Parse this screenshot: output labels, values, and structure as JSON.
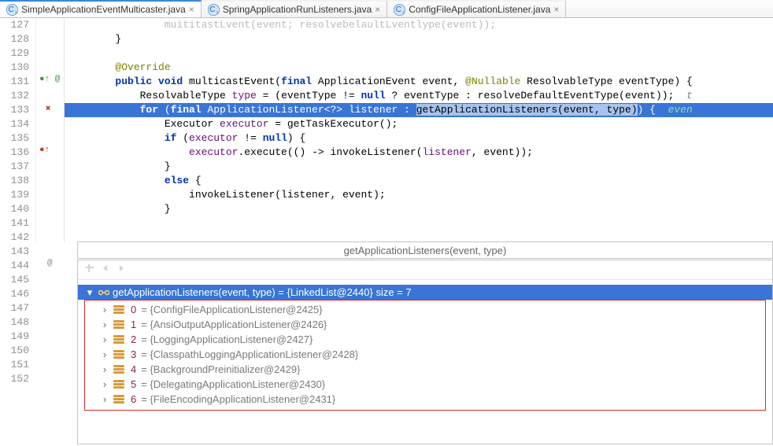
{
  "tabs": [
    {
      "label": "SimpleApplicationEventMulticaster.java",
      "active": true
    },
    {
      "label": "SpringApplicationRunListeners.java",
      "active": false
    },
    {
      "label": "ConfigFileApplicationListener.java",
      "active": false
    }
  ],
  "line_numbers": [
    "127",
    "128",
    "129",
    "130",
    "131",
    "132",
    "133",
    "134",
    "135",
    "136",
    "137",
    "138",
    "139",
    "140",
    "141",
    "142",
    "143",
    "144",
    "145",
    "146",
    "147",
    "148",
    "149",
    "150",
    "151",
    "152"
  ],
  "code": {
    "l0": "muititastLvent(event; resolvebelaultLventlype(event));",
    "l1": "}",
    "l3": "@Override",
    "l4_pre": "public void",
    "l4_name": " multicastEvent(",
    "l4_kw2": "final",
    "l4_mid": " ApplicationEvent event, ",
    "l4_ann": "@Nullable",
    "l4_rest": " ResolvableType eventType) {",
    "l5_pre": "ResolvableType ",
    "l5_var": "type",
    "l5_rest": " = (eventType != ",
    "l5_null": "null",
    "l5_rest2": " ? eventType : resolveDefaultEventType(event));  ",
    "l5_cmt": "t",
    "l6_pre": "for",
    "l6_mid": " (",
    "l6_fin": "final",
    "l6_mid2": " ApplicationListener<?> listener : ",
    "l6_sel": "getApplicationListeners(event, type)",
    "l6_end": ") {  ",
    "l6_cmt": "even",
    "l7_pre": "Executor ",
    "l7_var": "executor",
    "l7_rest": " = getTaskExecutor();",
    "l8_if": "if",
    "l8_mid": " (",
    "l8_var": "executor",
    "l8_rest": " != ",
    "l8_null": "null",
    "l8_rest2": ") {",
    "l9_var": "executor",
    "l9_rest": ".execute(() -> invokeListener(",
    "l9_var2": "listener",
    "l9_rest2": ", event));",
    "l10": "}",
    "l11_else": "else",
    "l11_rest": " {",
    "l12_rest": "invokeListener(listener, event);",
    "l13": "}"
  },
  "signature_popup": "getApplicationListeners(event, type)",
  "debug": {
    "root": "getApplicationListeners(event, type) = {LinkedList@2440}  size = 7",
    "items": [
      {
        "idx": "0",
        "val": " = {ConfigFileApplicationListener@2425}"
      },
      {
        "idx": "1",
        "val": " = {AnsiOutputApplicationListener@2426}"
      },
      {
        "idx": "2",
        "val": " = {LoggingApplicationListener@2427}"
      },
      {
        "idx": "3",
        "val": " = {ClasspathLoggingApplicationListener@2428}"
      },
      {
        "idx": "4",
        "val": " = {BackgroundPreinitializer@2429}"
      },
      {
        "idx": "5",
        "val": " = {DelegatingApplicationListener@2430}"
      },
      {
        "idx": "6",
        "val": " = {FileEncodingApplicationListener@2431}"
      }
    ]
  },
  "gutter": {
    "m131": "●↑ @",
    "m133": "✖",
    "m136": "●↑",
    "m144": "@"
  }
}
